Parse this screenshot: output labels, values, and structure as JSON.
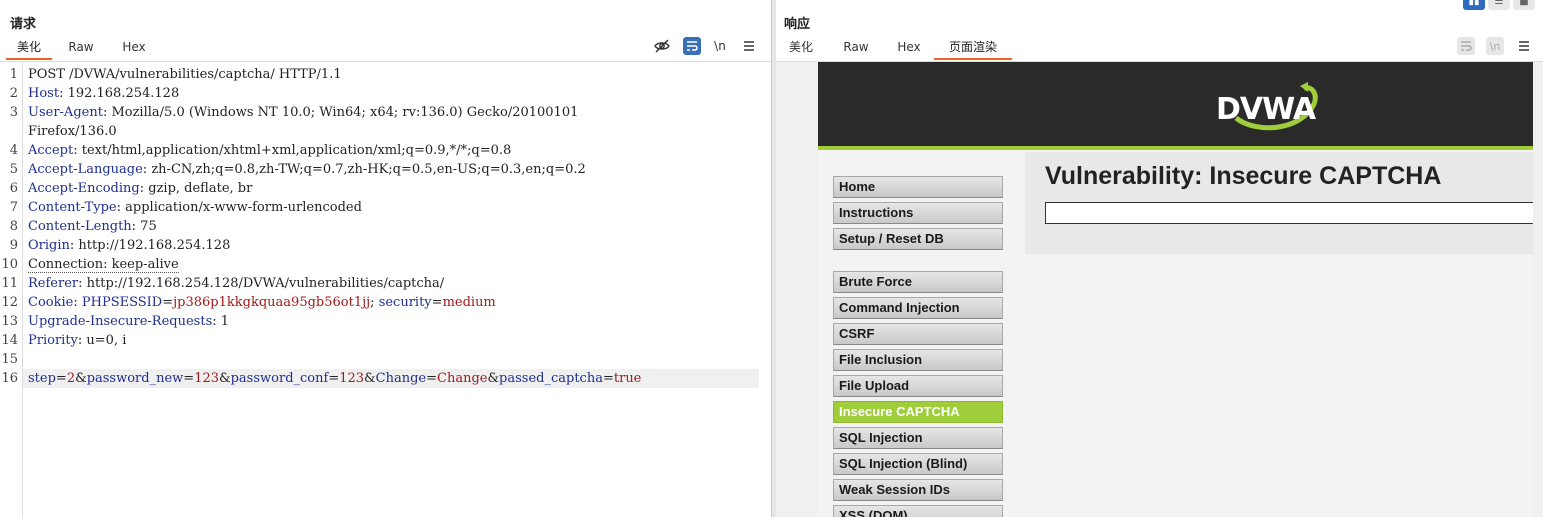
{
  "request": {
    "title": "请求",
    "tabs": [
      "美化",
      "Raw",
      "Hex"
    ],
    "active_tab": "美化",
    "toolbar_icons": [
      "eye-slash-icon",
      "wrap-lines-icon",
      "newline-icon",
      "menu-icon"
    ],
    "newline_label": "\\n",
    "lines": [
      {
        "n": "1",
        "parts": [
          {
            "t": "POST /DVWA/vulnerabilities/captcha/ HTTP/1.1",
            "c": ""
          }
        ]
      },
      {
        "n": "2",
        "parts": [
          {
            "t": "Host",
            "c": "k"
          },
          {
            "t": ": 192.168.254.128",
            "c": ""
          }
        ]
      },
      {
        "n": "3",
        "parts": [
          {
            "t": "User-Agent",
            "c": "k"
          },
          {
            "t": ": Mozilla/5.0 (Windows NT 10.0; Win64; x64; rv:136.0) Gecko/20100101",
            "c": ""
          }
        ]
      },
      {
        "n": "",
        "parts": [
          {
            "t": "Firefox/136.0",
            "c": ""
          }
        ]
      },
      {
        "n": "4",
        "parts": [
          {
            "t": "Accept",
            "c": "k"
          },
          {
            "t": ": text/html,application/xhtml+xml,application/xml;q=0.9,*/*;q=0.8",
            "c": ""
          }
        ]
      },
      {
        "n": "5",
        "parts": [
          {
            "t": "Accept-Language",
            "c": "k"
          },
          {
            "t": ": zh-CN,zh;q=0.8,zh-TW;q=0.7,zh-HK;q=0.5,en-US;q=0.3,en;q=0.2",
            "c": ""
          }
        ]
      },
      {
        "n": "6",
        "parts": [
          {
            "t": "Accept-Encoding",
            "c": "k"
          },
          {
            "t": ": gzip, deflate, br",
            "c": ""
          }
        ]
      },
      {
        "n": "7",
        "parts": [
          {
            "t": "Content-Type",
            "c": "k"
          },
          {
            "t": ": application/x-www-form-urlencoded",
            "c": ""
          }
        ]
      },
      {
        "n": "8",
        "parts": [
          {
            "t": "Content-Length",
            "c": "k"
          },
          {
            "t": ": 75",
            "c": ""
          }
        ]
      },
      {
        "n": "9",
        "parts": [
          {
            "t": "Origin",
            "c": "k"
          },
          {
            "t": ": http://192.168.254.128",
            "c": ""
          }
        ]
      },
      {
        "n": "10",
        "parts": [
          {
            "t": "Connection: keep-alive",
            "c": "dotted"
          }
        ]
      },
      {
        "n": "11",
        "parts": [
          {
            "t": "Referer",
            "c": "k"
          },
          {
            "t": ": http://192.168.254.128/DVWA/vulnerabilities/captcha/",
            "c": ""
          }
        ]
      },
      {
        "n": "12",
        "parts": [
          {
            "t": "Cookie",
            "c": "k"
          },
          {
            "t": ": ",
            "c": ""
          },
          {
            "t": "PHPSESSID",
            "c": "k"
          },
          {
            "t": "=",
            "c": ""
          },
          {
            "t": "jp386p1kkgkquaa95gb56ot1jj",
            "c": "pv"
          },
          {
            "t": "; ",
            "c": ""
          },
          {
            "t": "security",
            "c": "k"
          },
          {
            "t": "=",
            "c": ""
          },
          {
            "t": "medium",
            "c": "pv"
          }
        ]
      },
      {
        "n": "13",
        "parts": [
          {
            "t": "Upgrade-Insecure-Requests",
            "c": "k"
          },
          {
            "t": ": 1",
            "c": ""
          }
        ]
      },
      {
        "n": "14",
        "parts": [
          {
            "t": "Priority",
            "c": "k"
          },
          {
            "t": ": u=0, i",
            "c": ""
          }
        ]
      },
      {
        "n": "15",
        "parts": []
      },
      {
        "n": "16",
        "parts": [
          {
            "t": "step",
            "c": "k"
          },
          {
            "t": "=",
            "c": ""
          },
          {
            "t": "2",
            "c": "pv"
          },
          {
            "t": "&",
            "c": ""
          },
          {
            "t": "password_new",
            "c": "k"
          },
          {
            "t": "=",
            "c": ""
          },
          {
            "t": "123",
            "c": "pv"
          },
          {
            "t": "&",
            "c": ""
          },
          {
            "t": "password_conf",
            "c": "k"
          },
          {
            "t": "=",
            "c": ""
          },
          {
            "t": "123",
            "c": "pv"
          },
          {
            "t": "&",
            "c": ""
          },
          {
            "t": "Change",
            "c": "k"
          },
          {
            "t": "=",
            "c": ""
          },
          {
            "t": "Change",
            "c": "pv"
          },
          {
            "t": "&",
            "c": ""
          },
          {
            "t": "passed_captcha",
            "c": "k"
          },
          {
            "t": "=",
            "c": ""
          },
          {
            "t": "true",
            "c": "pv"
          }
        ],
        "highlight": true
      }
    ]
  },
  "response": {
    "title": "响应",
    "tabs": [
      "美化",
      "Raw",
      "Hex",
      "页面渲染"
    ],
    "active_tab": "页面渲染",
    "newline_label": "\\n",
    "layout_buttons": [
      "columns-icon",
      "rows-icon",
      "single-icon"
    ],
    "dvwa": {
      "logo": "DVWA",
      "heading": "Vulnerability: Insecure CAPTCHA",
      "menu_group_1": [
        "Home",
        "Instructions",
        "Setup / Reset DB"
      ],
      "menu_group_2": [
        "Brute Force",
        "Command Injection",
        "CSRF",
        "File Inclusion",
        "File Upload",
        "Insecure CAPTCHA",
        "SQL Injection",
        "SQL Injection (Blind)",
        "Weak Session IDs",
        "XSS (DOM)"
      ],
      "selected_item": "Insecure CAPTCHA"
    }
  },
  "colors": {
    "accent": "#e8622c",
    "header_key": "#1f2f8f",
    "param_value": "#a11919",
    "dvwa_green": "#9fce3a",
    "dvwa_dark": "#2a2a2a"
  }
}
